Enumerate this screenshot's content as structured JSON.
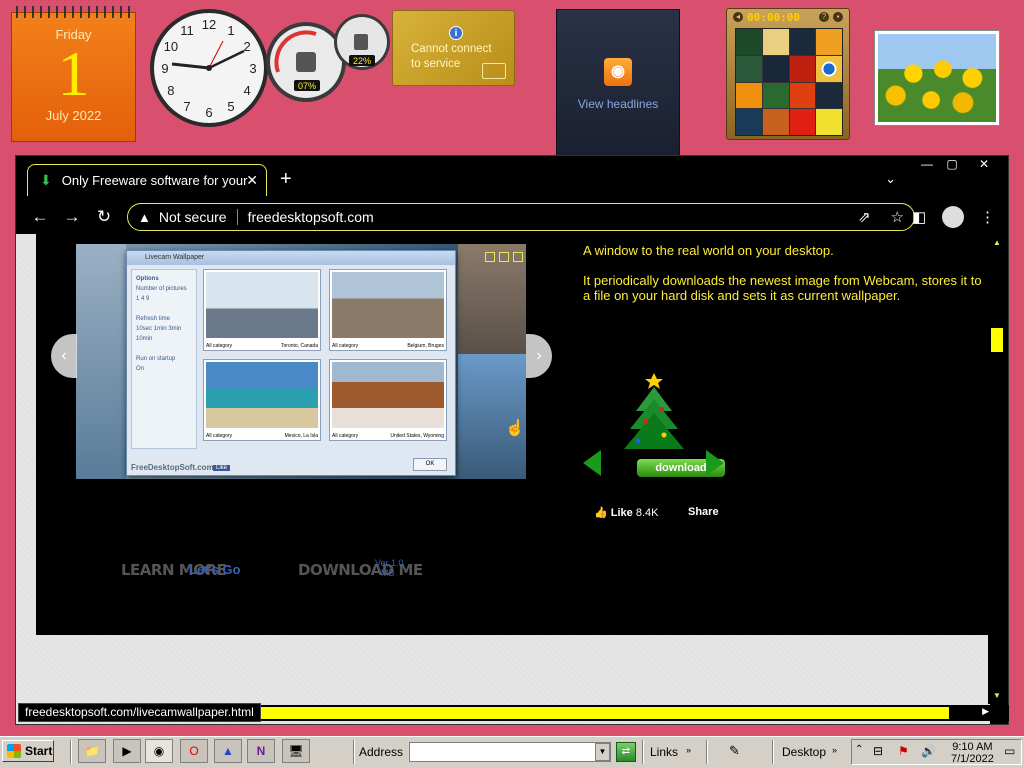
{
  "desktop": {
    "calendar": {
      "weekday": "Friday",
      "day": "1",
      "month_year": "July 2022"
    },
    "clock": {
      "numerals": [
        "12",
        "1",
        "2",
        "3",
        "4",
        "5",
        "6",
        "7",
        "8",
        "9",
        "10",
        "11"
      ]
    },
    "meter": {
      "cpu": "07%",
      "memory": "22%"
    },
    "weather": {
      "message_line1": "Cannot connect",
      "message_line2": "to service",
      "info_symbol": "i"
    },
    "feed": {
      "label": "View headlines"
    },
    "puzzle": {
      "timer": "00:00:00"
    },
    "photo": {
      "subject": "tulips"
    }
  },
  "browser": {
    "tab": {
      "title": "Only Freeware software for your",
      "close": "✕",
      "fav_icon": "download-arrow-icon"
    },
    "new_tab": "+",
    "tab_search": "⌄",
    "window_controls": {
      "minimize": "—",
      "maximize": "▢",
      "close": "✕"
    },
    "nav": {
      "back": "←",
      "forward": "→",
      "reload": "↻"
    },
    "address": {
      "security": "Not secure",
      "url": "freedesktopsoft.com"
    },
    "status_url": "freedesktopsoft.com/livecamwallpaper.html"
  },
  "page": {
    "slider_app": {
      "title": "Livecam Wallpaper",
      "sidebar": [
        "Options",
        "Number of pictures",
        "1   4   9",
        "Refresh time",
        "10sec 1min 3min 10min",
        "Run on startup",
        "On"
      ],
      "thumbnails": [
        {
          "category": "All category",
          "place": "Toronto, Canada"
        },
        {
          "category": "All category",
          "place": "Belgium, Bruges"
        },
        {
          "category": "All category",
          "place": "Mexico, La Isla"
        },
        {
          "category": "All category",
          "place": "United States, Wyoming"
        }
      ],
      "footer": "FreeDesktopSoft.com",
      "like_chip": "Like",
      "ok": "OK"
    },
    "description": [
      "A window to the real world on your desktop.",
      "It periodically downloads the newest image from Webcam, stores it to a file on your hard disk and sets it as current wallpaper."
    ],
    "download_button": "download",
    "facebook": {
      "like": "Like",
      "count": "8.4K",
      "share": "Share"
    },
    "learn_more": "LEARN MORE",
    "lets_go": "Let's Go",
    "download_me": "DOWNLOAD ME",
    "version": "Ver 1.0",
    "size": "MB"
  },
  "taskbar": {
    "start": "Start",
    "address_label": "Address",
    "links": "Links",
    "desktop": "Desktop",
    "time": "9:10 AM",
    "date": "7/1/2022"
  },
  "colors": {
    "accent_yellow": "#ffff00",
    "desktop_pink": "#d9506f",
    "text_yellow": "#ffee33"
  }
}
